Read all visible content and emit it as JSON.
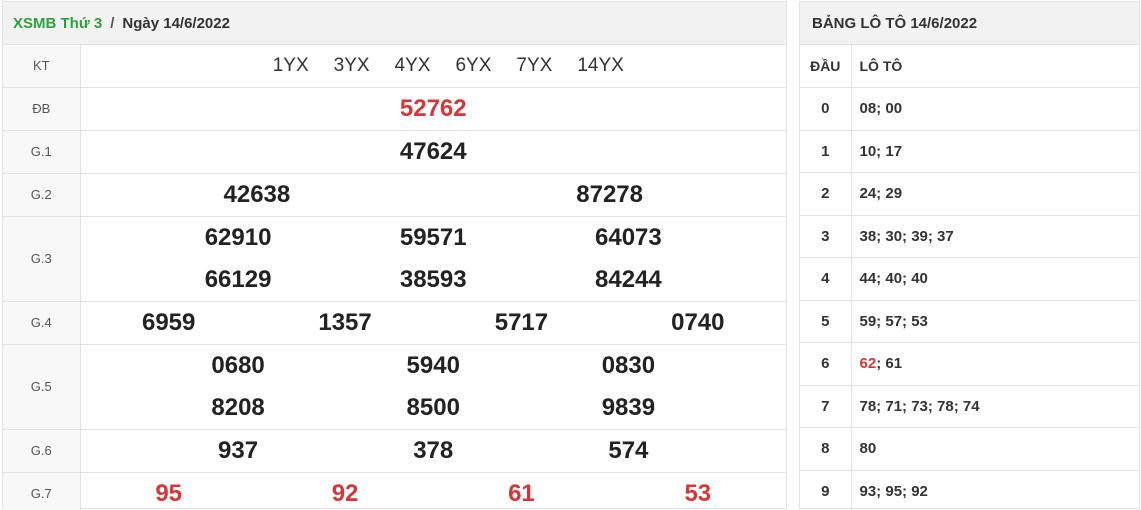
{
  "header": {
    "link": "XSMB Thứ 3",
    "separator": "/",
    "date": "Ngày 14/6/2022"
  },
  "kt": {
    "label": "KT",
    "codes": [
      "1YX",
      "3YX",
      "4YX",
      "6YX",
      "7YX",
      "14YX"
    ]
  },
  "prizes": {
    "db": {
      "label": "ĐB",
      "values": [
        "52762"
      ]
    },
    "g1": {
      "label": "G.1",
      "values": [
        "47624"
      ]
    },
    "g2": {
      "label": "G.2",
      "values": [
        "42638",
        "87278"
      ]
    },
    "g3": {
      "label": "G.3",
      "values": [
        "62910",
        "59571",
        "64073",
        "66129",
        "38593",
        "84244"
      ]
    },
    "g4": {
      "label": "G.4",
      "values": [
        "6959",
        "1357",
        "5717",
        "0740"
      ]
    },
    "g5": {
      "label": "G.5",
      "values": [
        "0680",
        "5940",
        "0830",
        "8208",
        "8500",
        "9839"
      ]
    },
    "g6": {
      "label": "G.6",
      "values": [
        "937",
        "378",
        "574"
      ]
    },
    "g7": {
      "label": "G.7",
      "values": [
        "95",
        "92",
        "61",
        "53"
      ]
    }
  },
  "loto": {
    "title": "BẢNG LÔ TÔ 14/6/2022",
    "head_dau": "ĐẦU",
    "head_loto": "LÔ TÔ",
    "rows": [
      {
        "dau": "0",
        "loto": "08; 00"
      },
      {
        "dau": "1",
        "loto": "10; 17"
      },
      {
        "dau": "2",
        "loto": "24; 29"
      },
      {
        "dau": "3",
        "loto": "38; 30; 39; 37"
      },
      {
        "dau": "4",
        "loto": "44; 40; 40"
      },
      {
        "dau": "5",
        "loto": "59; 57; 53"
      },
      {
        "dau": "6",
        "loto_special": "62",
        "loto_rest": "; 61"
      },
      {
        "dau": "7",
        "loto": "78; 71; 73; 78; 74"
      },
      {
        "dau": "8",
        "loto": "80"
      },
      {
        "dau": "9",
        "loto": "93; 95; 92"
      }
    ]
  },
  "colors": {
    "accent_green": "#2aa33b",
    "highlight_red": "#d63637"
  }
}
